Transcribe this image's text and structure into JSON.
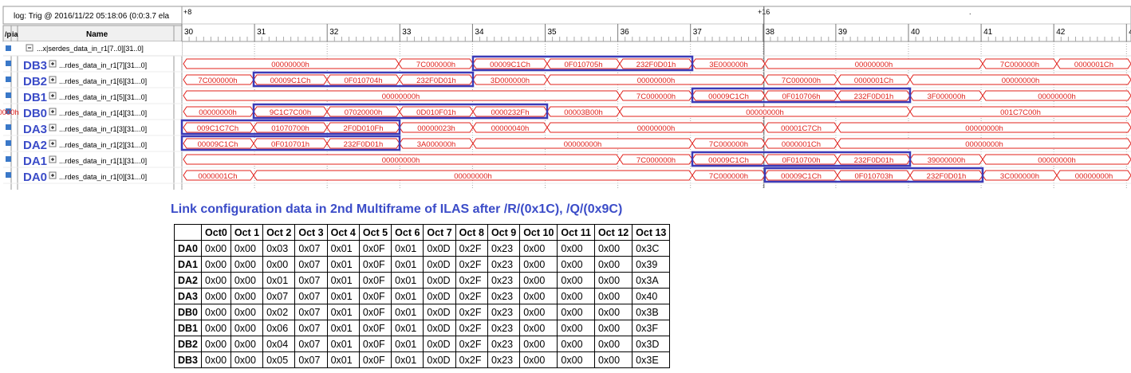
{
  "header": {
    "trig": "log: Trig @ 2016/11/22 05:18:06 (0:0:3.7 ela",
    "marker_plus8": "+8",
    "marker_plus16": "+16",
    "col_vp": "/p",
    "col_ia": "ia",
    "col_name": "Name",
    "ticks": [
      "30",
      "31",
      "32",
      "33",
      "34",
      "35",
      "36",
      "37",
      "38",
      "39",
      "40",
      "41",
      "42",
      "43"
    ]
  },
  "group_row": {
    "name": "...x|serdes_data_in_r1[7..0][31..0]"
  },
  "signals": [
    {
      "label": "DB3",
      "name": "...rdes_data_in_r1[7][31...0]",
      "segments": [
        {
          "v": "00000000h"
        },
        {
          "v": "7C000000h"
        },
        {
          "v": "00009C1Ch"
        },
        {
          "v": "0F010705h"
        },
        {
          "v": "232F0D01h"
        },
        {
          "v": "3E000000h"
        },
        {
          "v": "00000000h"
        },
        {
          "v": "7C000000h"
        },
        {
          "v": "0000001Ch"
        }
      ]
    },
    {
      "label": "DB2",
      "name": "...rdes_data_in_r1[6][31...0]",
      "segments": [
        {
          "v": "7C000000h"
        },
        {
          "v": "00009C1Ch"
        },
        {
          "v": "0F010704h"
        },
        {
          "v": "232F0D01h"
        },
        {
          "v": "3D000000h"
        },
        {
          "v": "00000000h"
        },
        {
          "v": "7C000000h"
        },
        {
          "v": "0000001Ch"
        },
        {
          "v": "00000000h"
        }
      ]
    },
    {
      "label": "DB1",
      "name": "...rdes_data_in_r1[5][31...0]",
      "segments": [
        {
          "v": "00000000h"
        },
        {
          "v": "7C000000h"
        },
        {
          "v": "00009C1Ch"
        },
        {
          "v": "0F010706h"
        },
        {
          "v": "232F0D01h"
        },
        {
          "v": "3F000000h"
        },
        {
          "v": "00000000h"
        }
      ]
    },
    {
      "label": "DB0",
      "name": "...rdes_data_in_r1[4][31...0]",
      "segments": [
        {
          "v": "00000000h"
        },
        {
          "v": "9C1C7C00h"
        },
        {
          "v": "07020000h"
        },
        {
          "v": "0D010F01h"
        },
        {
          "v": "0000232Fh"
        },
        {
          "v": "00003B00h"
        },
        {
          "v": "00000000h"
        },
        {
          "v": "001C7C00h"
        },
        {
          "v": "00000000h"
        }
      ]
    },
    {
      "label": "DA3",
      "name": "...rdes_data_in_r1[3][31...0]",
      "segments": [
        {
          "v": "009C1C7Ch"
        },
        {
          "v": "01070700h"
        },
        {
          "v": "2F0D010Fh"
        },
        {
          "v": "00000023h"
        },
        {
          "v": "00000040h"
        },
        {
          "v": "00000000h"
        },
        {
          "v": "00001C7Ch"
        },
        {
          "v": "00000000h"
        }
      ]
    },
    {
      "label": "DA2",
      "name": "...rdes_data_in_r1[2][31...0]",
      "segments": [
        {
          "v": "00009C1Ch"
        },
        {
          "v": "0F010701h"
        },
        {
          "v": "232F0D01h"
        },
        {
          "v": "3A000000h"
        },
        {
          "v": "00000000h"
        },
        {
          "v": "7C000000h"
        },
        {
          "v": "0000001Ch"
        },
        {
          "v": "00000000h"
        }
      ]
    },
    {
      "label": "DA1",
      "name": "...rdes_data_in_r1[1][31...0]",
      "segments": [
        {
          "v": "00000000h"
        },
        {
          "v": "7C000000h"
        },
        {
          "v": "00009C1Ch"
        },
        {
          "v": "0F010700h"
        },
        {
          "v": "232F0D01h"
        },
        {
          "v": "39000000h"
        },
        {
          "v": "00000000h"
        }
      ]
    },
    {
      "label": "DA0",
      "name": "...rdes_data_in_r1[0][31...0]",
      "segments": [
        {
          "v": "0000001Ch"
        },
        {
          "v": "00000000h"
        },
        {
          "v": "7C000000h"
        },
        {
          "v": "00009C1Ch"
        },
        {
          "v": "0F010703h"
        },
        {
          "v": "232F0D01h"
        },
        {
          "v": "3C000000h"
        },
        {
          "v": "00000000h"
        }
      ]
    }
  ],
  "colors": {
    "waveform": "#e0201a",
    "highlight": "#3b3bb8",
    "label": "#3b4cc8",
    "grid": "#a8a8a8"
  },
  "caption": "Link configuration data in 2nd Multiframe of ILAS after /R/(0x1C), /Q/(0x9C)",
  "table": {
    "headers": [
      "",
      "Oct0",
      "Oct 1",
      "Oct 2",
      "Oct 3",
      "Oct 4",
      "Oct 5",
      "Oct 6",
      "Oct 7",
      "Oct 8",
      "Oct 9",
      "Oct 10",
      "Oct 11",
      "Oct 12",
      "Oct 13"
    ],
    "rows": [
      [
        "DA0",
        "0x00",
        "0x00",
        "0x03",
        "0x07",
        "0x01",
        "0x0F",
        "0x01",
        "0x0D",
        "0x2F",
        "0x23",
        "0x00",
        "0x00",
        "0x00",
        "0x3C"
      ],
      [
        "DA1",
        "0x00",
        "0x00",
        "0x00",
        "0x07",
        "0x01",
        "0x0F",
        "0x01",
        "0x0D",
        "0x2F",
        "0x23",
        "0x00",
        "0x00",
        "0x00",
        "0x39"
      ],
      [
        "DA2",
        "0x00",
        "0x00",
        "0x01",
        "0x07",
        "0x01",
        "0x0F",
        "0x01",
        "0x0D",
        "0x2F",
        "0x23",
        "0x00",
        "0x00",
        "0x00",
        "0x3A"
      ],
      [
        "DA3",
        "0x00",
        "0x00",
        "0x07",
        "0x07",
        "0x01",
        "0x0F",
        "0x01",
        "0x0D",
        "0x2F",
        "0x23",
        "0x00",
        "0x00",
        "0x00",
        "0x40"
      ],
      [
        "DB0",
        "0x00",
        "0x00",
        "0x02",
        "0x07",
        "0x01",
        "0x0F",
        "0x01",
        "0x0D",
        "0x2F",
        "0x23",
        "0x00",
        "0x00",
        "0x00",
        "0x3B"
      ],
      [
        "DB1",
        "0x00",
        "0x00",
        "0x06",
        "0x07",
        "0x01",
        "0x0F",
        "0x01",
        "0x0D",
        "0x2F",
        "0x23",
        "0x00",
        "0x00",
        "0x00",
        "0x3F"
      ],
      [
        "DB2",
        "0x00",
        "0x00",
        "0x04",
        "0x07",
        "0x01",
        "0x0F",
        "0x01",
        "0x0D",
        "0x2F",
        "0x23",
        "0x00",
        "0x00",
        "0x00",
        "0x3D"
      ],
      [
        "DB3",
        "0x00",
        "0x00",
        "0x05",
        "0x07",
        "0x01",
        "0x0F",
        "0x01",
        "0x0D",
        "0x2F",
        "0x23",
        "0x00",
        "0x00",
        "0x00",
        "0x3E"
      ]
    ]
  }
}
